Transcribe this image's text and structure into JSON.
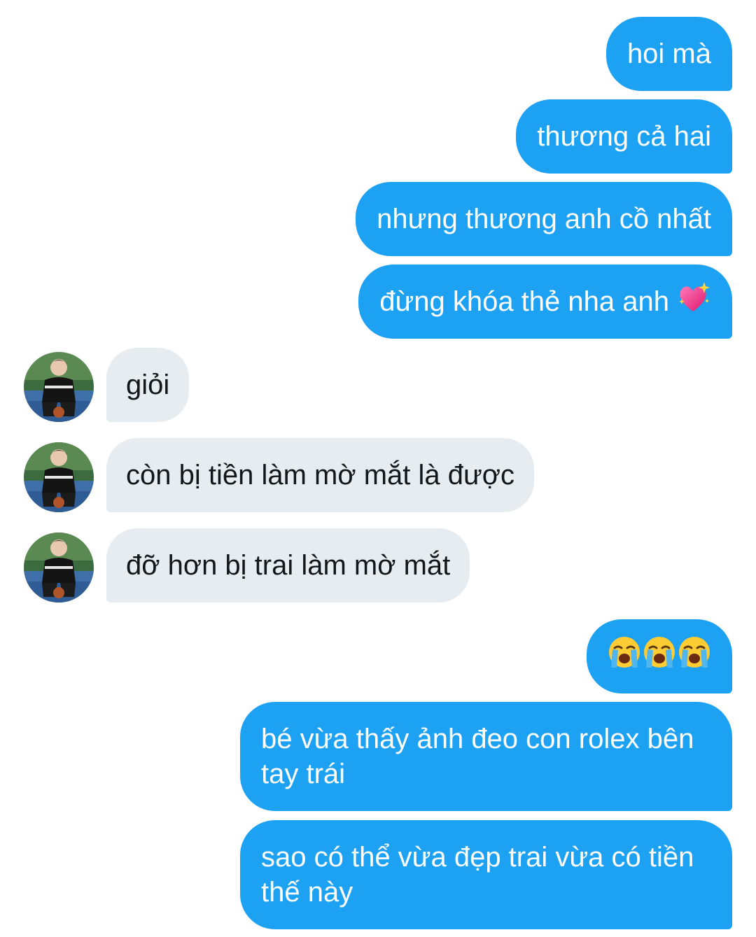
{
  "conversation": {
    "outgoing_1": {
      "text": "hoi mà"
    },
    "outgoing_2": {
      "text": "thương cả hai"
    },
    "outgoing_3": {
      "text": "nhưng thương anh cồ nhất"
    },
    "outgoing_4": {
      "text": "đừng khóa thẻ nha anh",
      "emoji": "sparkling-heart-icon"
    },
    "incoming_1": {
      "text": "giỏi"
    },
    "incoming_2": {
      "text": "còn bị tiền làm mờ mắt là được"
    },
    "incoming_3": {
      "text": "đỡ hơn bị trai làm mờ mắt"
    },
    "outgoing_5": {
      "emoji": [
        "loudly-crying-face-icon",
        "loudly-crying-face-icon",
        "loudly-crying-face-icon"
      ]
    },
    "outgoing_6": {
      "text": "bé vừa thấy ảnh đeo con rolex bên tay trái"
    },
    "outgoing_7": {
      "text": "sao có thể vừa đẹp trai vừa có tiền thế này"
    }
  },
  "colors": {
    "outgoing_bubble": "#1da1f2",
    "incoming_bubble": "#e6ecf0",
    "outgoing_text": "#ffffff",
    "incoming_text": "#14171a"
  }
}
